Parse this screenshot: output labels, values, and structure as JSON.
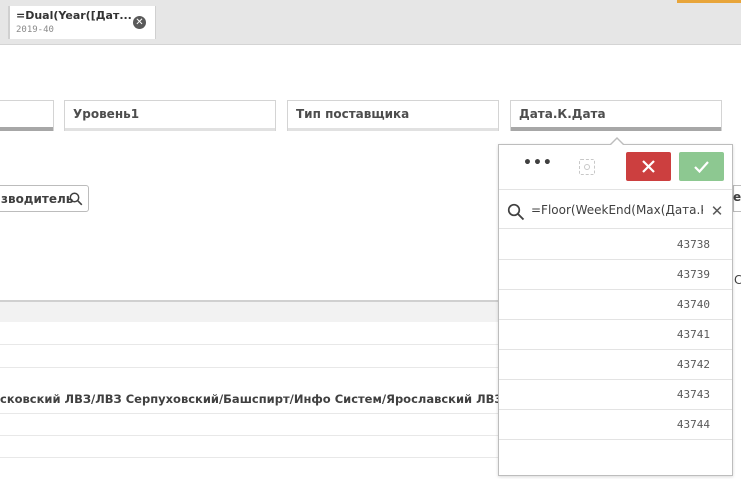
{
  "selections_bar": {
    "chip": {
      "title": "=Dual(Year([Дат...",
      "value": "2019-40"
    }
  },
  "filters": [
    {
      "title": ""
    },
    {
      "title": "Уровень1"
    },
    {
      "title": "Тип поставщика"
    },
    {
      "title": "Дата.К.Дата"
    }
  ],
  "search_button": {
    "label": "зводитель"
  },
  "table": {
    "rows": [
      "",
      "",
      "сковский ЛВЗ/ЛВЗ Серпуховский/Башспирт/Инфо Систем/Ярославский ЛВЗ/Усадьба",
      "",
      ""
    ]
  },
  "edge_fragments": {
    "right_top": "er",
    "right_mid": "С"
  },
  "listbox": {
    "search_value": "=Floor(WeekEnd(Max(Дата.К.Дата)))",
    "items": [
      "43738",
      "43739",
      "43740",
      "43741",
      "43742",
      "43743",
      "43744"
    ]
  },
  "colors": {
    "cancel": "#cc3f3f",
    "confirm": "#8dc891",
    "accent": "#e8a53a"
  }
}
